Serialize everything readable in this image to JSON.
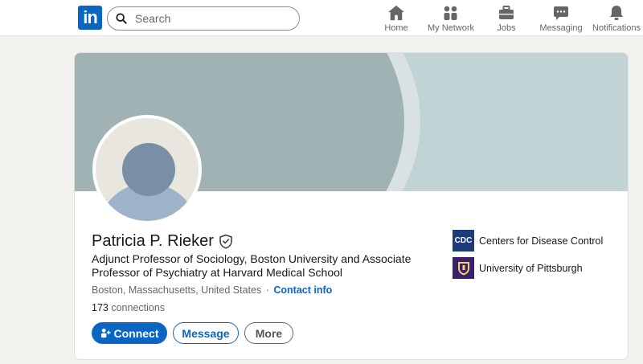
{
  "nav": {
    "logo_text": "in",
    "search_placeholder": "Search",
    "items": [
      {
        "label": "Home",
        "icon": "home-icon"
      },
      {
        "label": "My Network",
        "icon": "people-icon"
      },
      {
        "label": "Jobs",
        "icon": "briefcase-icon"
      },
      {
        "label": "Messaging",
        "icon": "message-icon"
      },
      {
        "label": "Notifications",
        "icon": "bell-icon"
      }
    ]
  },
  "profile": {
    "name": "Patricia P. Rieker",
    "headline": "Adjunct Professor of Sociology, Boston University and Associate Professor of Psychiatry at Harvard Medical School",
    "location": "Boston, Massachusetts, United States",
    "separator": "·",
    "contact_info": "Contact info",
    "connections_count": "173",
    "connections_label": "connections",
    "verified_icon": "verified-shield-icon"
  },
  "actions": {
    "connect": "Connect",
    "message": "Message",
    "more": "More"
  },
  "organizations": [
    {
      "name": "Centers for Disease Control",
      "logo_text": "CDC",
      "logo_color": "#1c3b7a"
    },
    {
      "name": "University of Pittsburgh",
      "logo_color": "#3a1f6b"
    }
  ],
  "colors": {
    "brand": "#0a66c2",
    "banner_dark": "#a1b2b5",
    "banner_light": "#c2d3d6"
  }
}
